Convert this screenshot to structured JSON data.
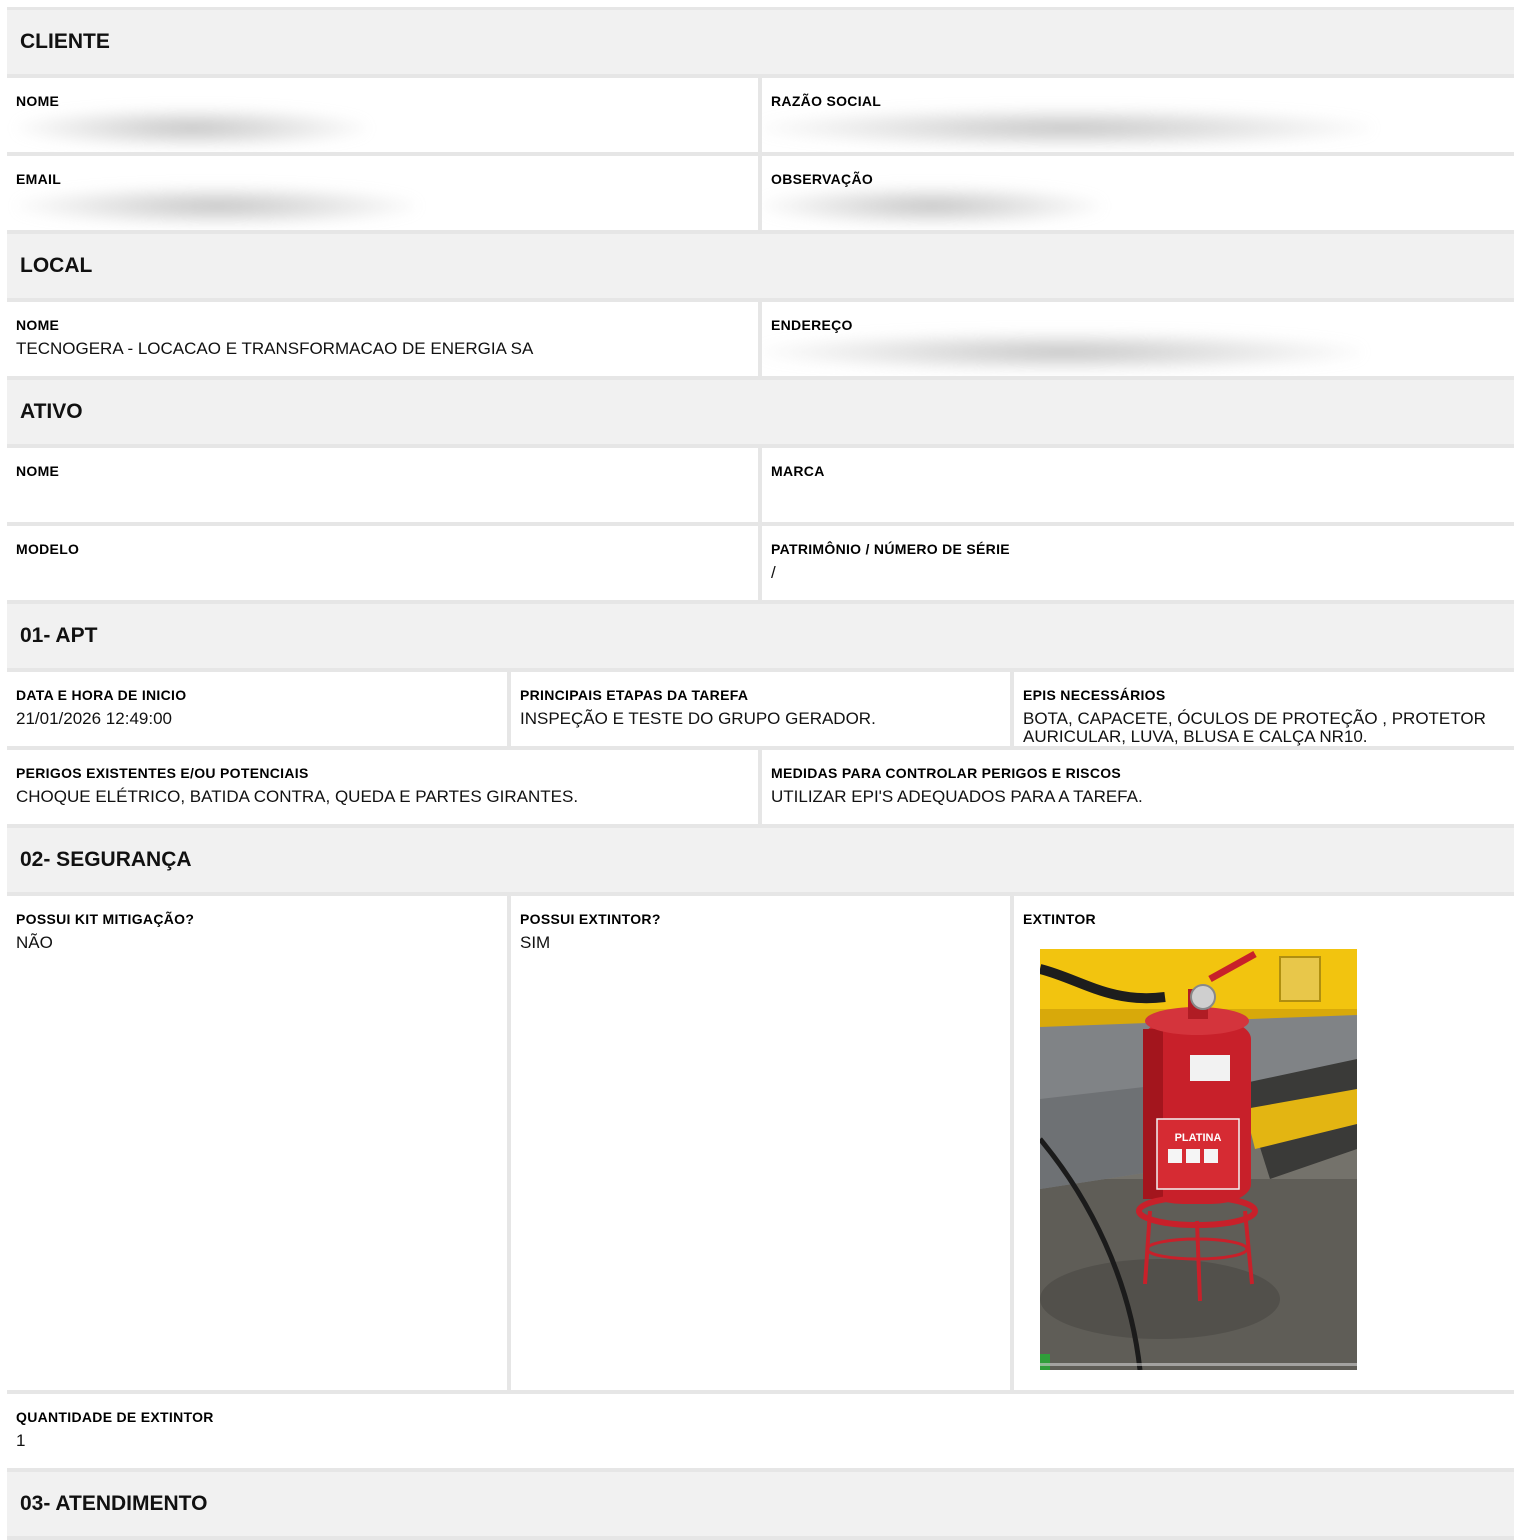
{
  "sections": {
    "cliente": {
      "title": "CLIENTE",
      "nome_label": "NOME",
      "razao_label": "RAZÃO SOCIAL",
      "email_label": "EMAIL",
      "observacao_label": "OBSERVAÇÃO"
    },
    "local": {
      "title": "LOCAL",
      "nome_label": "NOME",
      "nome_value": "TECNOGERA - LOCACAO E TRANSFORMACAO DE ENERGIA SA",
      "endereco_label": "ENDEREÇO"
    },
    "ativo": {
      "title": "ATIVO",
      "nome_label": "NOME",
      "marca_label": "MARCA",
      "modelo_label": "MODELO",
      "patrimonio_label": "PATRIMÔNIO / NÚMERO DE SÉRIE",
      "patrimonio_value": "/"
    },
    "apt": {
      "title": "01- APT",
      "data_label": "DATA E HORA DE INICIO",
      "data_value": "21/01/2026 12:49:00",
      "etapas_label": "PRINCIPAIS ETAPAS DA TAREFA",
      "etapas_value": "INSPEÇÃO E TESTE DO GRUPO GERADOR.",
      "epis_label": "EPIS NECESSÁRIOS",
      "epis_value": "BOTA, CAPACETE, ÓCULOS DE PROTEÇÃO , PROTETOR AURICULAR, LUVA, BLUSA E CALÇA NR10.",
      "perigos_label": "PERIGOS EXISTENTES E/OU POTENCIAIS",
      "perigos_value": "CHOQUE ELÉTRICO, BATIDA CONTRA, QUEDA E PARTES GIRANTES.",
      "medidas_label": "MEDIDAS PARA CONTROLAR PERIGOS E RISCOS",
      "medidas_value": "UTILIZAR EPI'S ADEQUADOS PARA A TAREFA."
    },
    "seguranca": {
      "title": "02- SEGURANÇA",
      "kit_label": "POSSUI KIT MITIGAÇÃO?",
      "kit_value": "NÃO",
      "extintor_label": "POSSUI EXTINTOR?",
      "extintor_value": "SIM",
      "foto_label": "EXTINTOR",
      "foto_brand_text": "PLATINA",
      "quantidade_label": "QUANTIDADE DE EXTINTOR",
      "quantidade_value": "1"
    },
    "atendimento": {
      "title": "03- ATENDIMENTO"
    }
  },
  "colors": {
    "page_bg": "#ffffff",
    "grid": "#e6e6e6",
    "header_bg": "#f1f1f1",
    "extinguisher_red": "#c8202a",
    "machine_yellow": "#f2c40f"
  }
}
